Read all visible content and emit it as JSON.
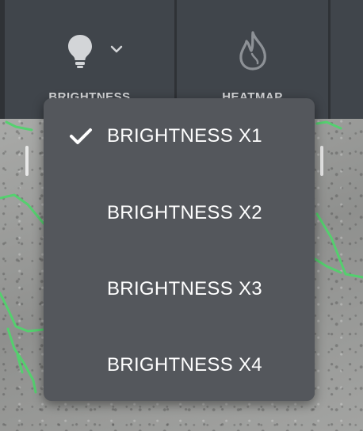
{
  "toolbar": {
    "tools": [
      {
        "label": "BRIGHTNESS",
        "icon": "lightbulb-icon",
        "dropdown_icon": "chevron-down-icon"
      },
      {
        "label": "HEATMAP",
        "icon": "flame-icon"
      }
    ]
  },
  "brightness_menu": {
    "items": [
      {
        "label": "BRIGHTNESS X1",
        "selected": true,
        "check_icon": "check-icon"
      },
      {
        "label": "BRIGHTNESS X2",
        "selected": false
      },
      {
        "label": "BRIGHTNESS X3",
        "selected": false
      },
      {
        "label": "BRIGHTNESS X4",
        "selected": false
      }
    ]
  },
  "colors": {
    "toolbar_bg": "#40454b",
    "menu_bg": "#54575c",
    "crack_overlay": "#4ed66b",
    "text": "#ffffff"
  }
}
